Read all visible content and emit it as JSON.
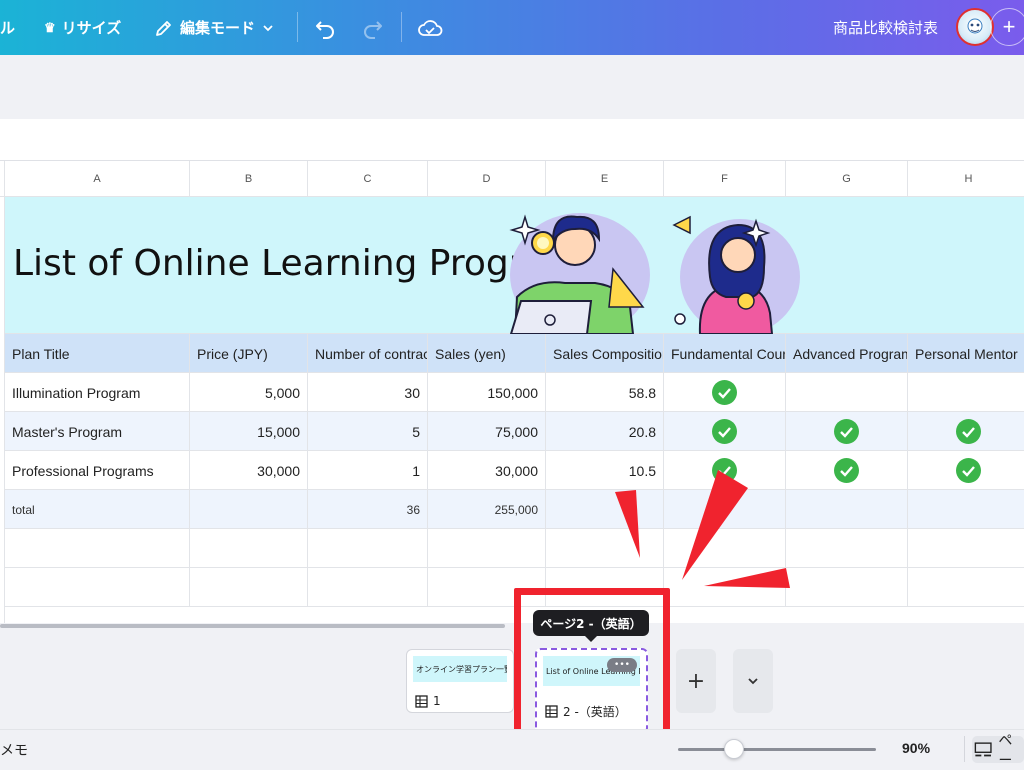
{
  "topbar": {
    "file_fragment": "ル",
    "resize_label": "リサイズ",
    "edit_mode_label": "編集モード",
    "doc_title": "商品比較検討表",
    "add_label": "+"
  },
  "sheet": {
    "columns": [
      "A",
      "B",
      "C",
      "D",
      "E",
      "F",
      "G",
      "H"
    ],
    "title": "List of Online Learning Programs",
    "headers": [
      "Plan Title",
      "Price (JPY)",
      "Number of contracts",
      "Sales (yen)",
      "Sales Composition",
      "Fundamental Course",
      "Advanced Program",
      "Personal Mentor"
    ],
    "rows": [
      {
        "plan": "Illumination Program",
        "price": "5,000",
        "contracts": "30",
        "sales": "150,000",
        "composition": "58.8",
        "fundamental": true,
        "advanced": false,
        "mentor": false
      },
      {
        "plan": "Master's Program",
        "price": "15,000",
        "contracts": "5",
        "sales": "75,000",
        "composition": "20.8",
        "fundamental": true,
        "advanced": true,
        "mentor": true
      },
      {
        "plan": "Professional Programs",
        "price": "30,000",
        "contracts": "1",
        "sales": "30,000",
        "composition": "10.5",
        "fundamental": true,
        "advanced": true,
        "mentor": true
      }
    ],
    "total": {
      "label": "total",
      "contracts": "36",
      "sales": "255,000"
    }
  },
  "pages": {
    "tooltip": "ページ2 -（英語）",
    "page1": {
      "thumb_text": "オンライン学習プラン一覧",
      "label": "1"
    },
    "page2": {
      "thumb_text": "List of Online Learning Pr",
      "label": "2 -（英語）",
      "more": "•••"
    },
    "add": "+",
    "expand": "⌄"
  },
  "footer": {
    "notes_fragment": "メモ",
    "zoom": "90%",
    "zoom_fraction": 0.28,
    "pages_fragment": "ペー"
  },
  "colors": {
    "accent_start": "#1bb3d6",
    "accent_end": "#7a5cec",
    "header_row": "#cfe2f8",
    "title_row": "#cff6fb",
    "check": "#3bb54a",
    "annotation_red": "#f0232e"
  }
}
